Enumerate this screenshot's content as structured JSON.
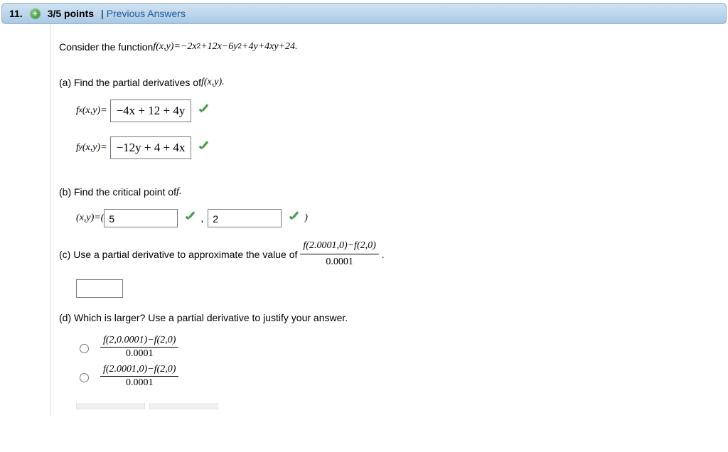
{
  "header": {
    "number": "11.",
    "expand_symbol": "+",
    "points": "3/5 points",
    "divider": "|",
    "prev_answers": "Previous Answers"
  },
  "intro": {
    "text_pre": "Consider the function  ",
    "expr_lhs": "f(x,y)=",
    "expr_rhs": "−2x",
    "expr_rhs2": "+12x−6y",
    "expr_rhs3": "+4y+4xy+24."
  },
  "partA": {
    "label": "(a) Find the partial derivatives of ",
    "label_f": "f(x,y).",
    "fx_label_pre": "f",
    "fx_label_sub": "x",
    "fx_label_post": "(x,y)=",
    "fx_answer": "−4x + 12 + 4y",
    "fy_label_pre": "f",
    "fy_label_sub": "y",
    "fy_label_post": "(x,y)=",
    "fy_answer": "−12y + 4 + 4x"
  },
  "partB": {
    "label": "(b) Find the critical point of ",
    "label_f": "f.",
    "xy_pre": "(x,y)=( ",
    "x_val": "5",
    "comma": ",",
    "y_val": "2",
    "close": ")"
  },
  "partC": {
    "label": "(c) Use a partial derivative to approximate the value of",
    "frac_num": "f(2.0001,0)−f(2,0)",
    "frac_den": "0.0001",
    "period": "."
  },
  "partD": {
    "label": "(d) Which is larger? Use a partial derivative to justify your answer.",
    "opt1_num": "f(2,0.0001)−f(2,0)",
    "opt1_den": "0.0001",
    "opt2_num": "f(2.0001,0)−f(2,0)",
    "opt2_den": "0.0001"
  }
}
